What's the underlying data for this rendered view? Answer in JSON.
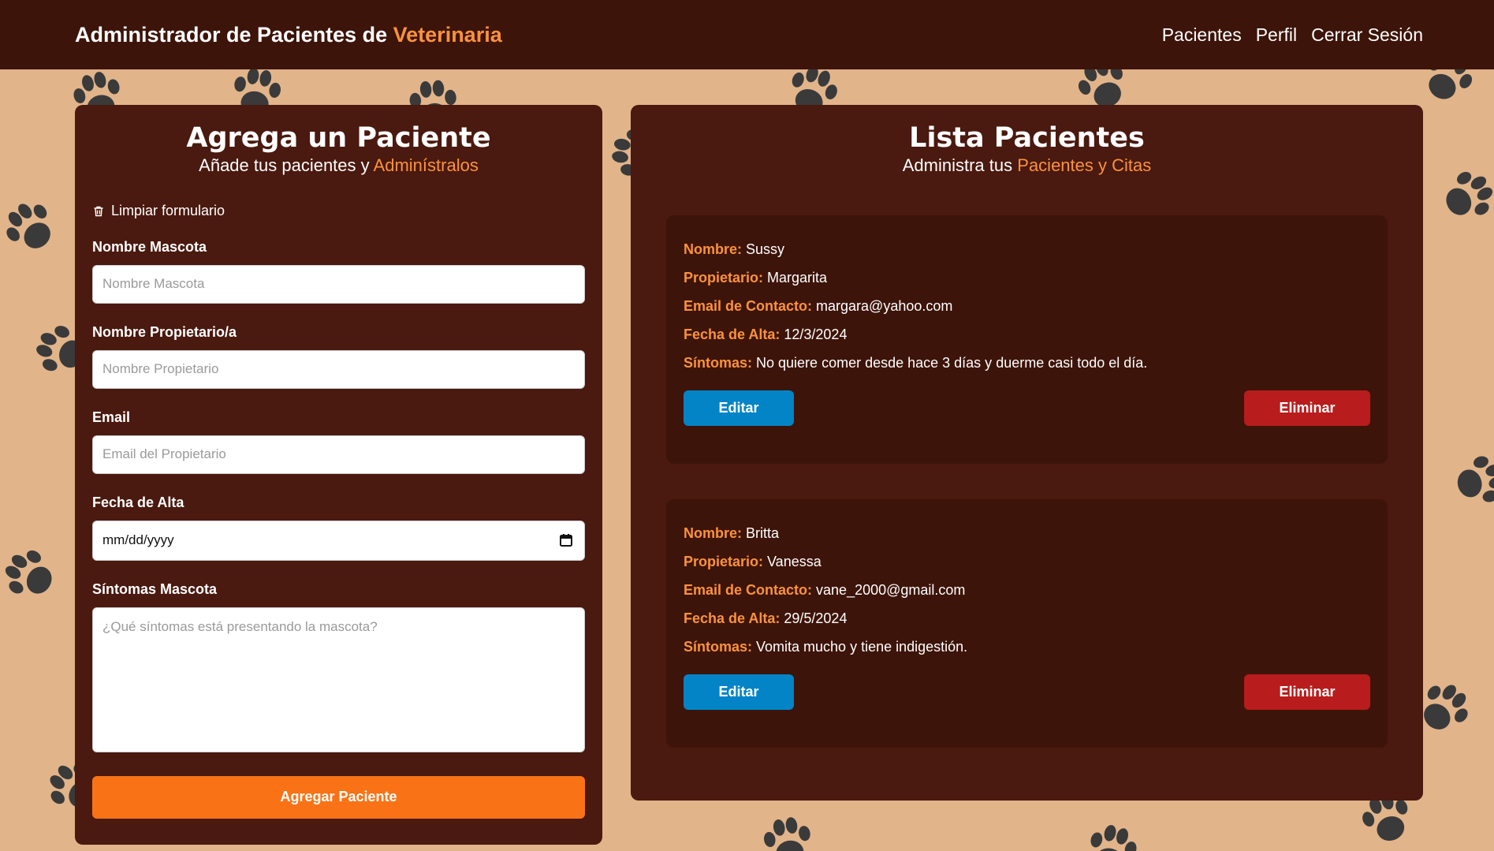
{
  "navbar": {
    "brand_prefix": "Administrador de Pacientes de",
    "brand_accent": "Veterinaria",
    "links": [
      "Pacientes",
      "Perfil",
      "Cerrar Sesión"
    ]
  },
  "form": {
    "title": "Agrega un Paciente",
    "subtitle_prefix": "Añade tus pacientes y",
    "subtitle_accent": "Adminístralos",
    "clear_label": "Limpiar formulario",
    "fields": {
      "pet_name": {
        "label": "Nombre Mascota",
        "placeholder": "Nombre Mascota",
        "value": ""
      },
      "owner_name": {
        "label": "Nombre Propietario/a",
        "placeholder": "Nombre Propietario",
        "value": ""
      },
      "email": {
        "label": "Email",
        "placeholder": "Email del Propietario",
        "value": ""
      },
      "date": {
        "label": "Fecha de Alta",
        "display_value": "mm/dd/yyyy"
      },
      "symptoms": {
        "label": "Síntomas Mascota",
        "placeholder": "¿Qué síntomas está presentando la mascota?",
        "value": ""
      }
    },
    "submit_label": "Agregar Paciente"
  },
  "list": {
    "title": "Lista Pacientes",
    "subtitle_prefix": "Administra tus",
    "subtitle_accent": "Pacientes y Citas",
    "field_labels": {
      "name": "Nombre:",
      "owner": "Propietario:",
      "email": "Email de Contacto:",
      "date": "Fecha de Alta:",
      "symptoms": "Síntomas:"
    },
    "patients": [
      {
        "name": "Sussy",
        "owner": "Margarita",
        "email": "margara@yahoo.com",
        "date": "12/3/2024",
        "symptoms": "No quiere comer desde hace 3 días y duerme casi todo el día."
      },
      {
        "name": "Britta",
        "owner": "Vanessa",
        "email": "vane_2000@gmail.com",
        "date": "29/5/2024",
        "symptoms": "Vomita mucho y tiene indigestión."
      }
    ],
    "edit_label": "Editar",
    "delete_label": "Eliminar"
  },
  "colors": {
    "background": "#e1b48a",
    "navbar": "#3d140a",
    "panel": "#4a190f",
    "card": "#3d140a",
    "accent": "#fb923c",
    "primary_button": "#f97316",
    "edit_button": "#0284c7",
    "delete_button": "#b91c1c",
    "paw": "#3a3a3a"
  },
  "icons": {
    "clear": "trash-icon",
    "date": "calendar-icon",
    "background_pattern": "paw-print-icon"
  }
}
